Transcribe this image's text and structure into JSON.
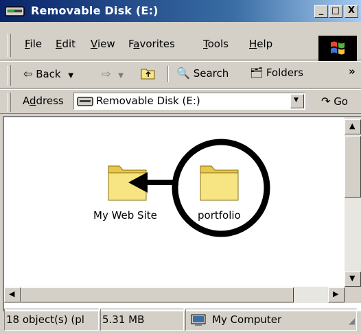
{
  "window": {
    "title": "Removable Disk (E:)",
    "title_icon": "drive-icon",
    "controls": {
      "minimize": "_",
      "maximize": "□",
      "close": "X"
    }
  },
  "menu": {
    "items": [
      {
        "label": "File",
        "accel": "F",
        "rest": "ile"
      },
      {
        "label": "Edit",
        "accel": "E",
        "rest": "dit"
      },
      {
        "label": "View",
        "accel": "V",
        "rest": "iew"
      },
      {
        "label": "Favorites",
        "pre": "F",
        "accel": "a",
        "rest": "vorites"
      },
      {
        "label": "Tools",
        "accel": "T",
        "rest": "ools"
      },
      {
        "label": "Help",
        "accel": "H",
        "rest": "elp"
      }
    ],
    "logo": "windows-logo"
  },
  "toolbar": {
    "back_label": "Back",
    "search_label": "Search",
    "folders_label": "Folders",
    "more_label": "»"
  },
  "address": {
    "label_pre": "A",
    "label_accel": "d",
    "label_rest": "dress",
    "value": "Removable Disk (E:)",
    "go_label": "Go"
  },
  "content": {
    "folders": [
      {
        "name": "My Web Site"
      },
      {
        "name": "portfolio"
      }
    ],
    "annotation": {
      "shape": "circle-with-arrow",
      "from": "portfolio",
      "to": "My Web Site"
    }
  },
  "statusbar": {
    "objects": "18 object(s) (pl",
    "size": "5.31 MB",
    "zone": "My Computer"
  },
  "colors": {
    "titlebar_start": "#0a246a",
    "titlebar_end": "#a6caf0",
    "chrome": "#d4d0c8",
    "folder": "#f7e483"
  }
}
